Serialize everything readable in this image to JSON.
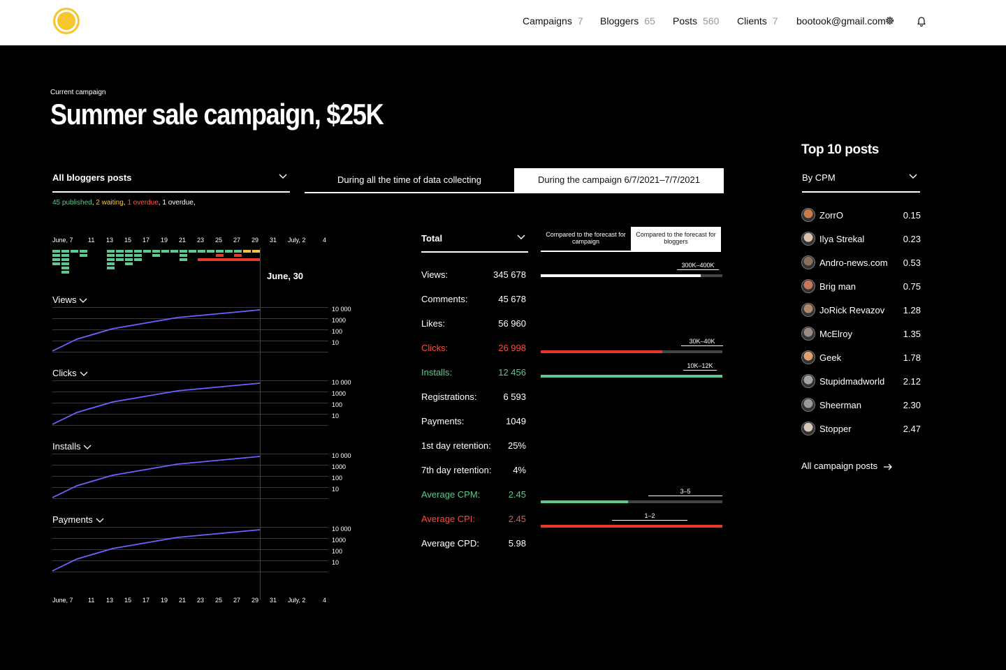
{
  "nav": {
    "items": [
      {
        "label": "Campaigns",
        "count": "7"
      },
      {
        "label": "Bloggers",
        "count": "65"
      },
      {
        "label": "Posts",
        "count": "560"
      },
      {
        "label": "Clients",
        "count": "7"
      }
    ],
    "email": "bootook@gmail.com",
    "icons": {
      "logo": "logo-circle",
      "settings": "gear-icon",
      "notifications": "bell-icon"
    },
    "logo_color": "#f5c62e"
  },
  "header": {
    "eyebrow": "Current campaign",
    "title": "Summer sale campaign, $25K"
  },
  "filter": {
    "label": "All bloggers posts",
    "summary": {
      "published": "45 published",
      "waiting": "2 waiting",
      "overdue_red": "1 overdue",
      "overdue": "1 overdue"
    }
  },
  "tabs": [
    {
      "label": "During all the time of data collecting",
      "active": false
    },
    {
      "label": "During the campaign 6/7/2021–7/7/2021",
      "active": true
    }
  ],
  "timeline": {
    "ticks": [
      "June, 7",
      "11",
      "13",
      "15",
      "17",
      "19",
      "21",
      "23",
      "25",
      "27",
      "29",
      "31",
      "July, 2",
      "4"
    ],
    "marker_label": "June, 30",
    "colors": {
      "published": "#5dc98f",
      "waiting": "#f0c73d",
      "overdue": "#e8392a"
    }
  },
  "metrics": [
    {
      "label": "Views",
      "scale": [
        "10 000",
        "1000",
        "100",
        "10"
      ]
    },
    {
      "label": "Clicks",
      "scale": [
        "10 000",
        "1000",
        "100",
        "10"
      ]
    },
    {
      "label": "Installs",
      "scale": [
        "10 000",
        "1000",
        "100",
        "10"
      ]
    },
    {
      "label": "Payments",
      "scale": [
        "10 000",
        "1000",
        "100",
        "10"
      ]
    }
  ],
  "totals": {
    "label": "Total",
    "rows": [
      {
        "name": "Views:",
        "value": "345 678",
        "tone": "white"
      },
      {
        "name": "Comments:",
        "value": "45 678",
        "tone": "white"
      },
      {
        "name": "Likes:",
        "value": "56 960",
        "tone": "white"
      },
      {
        "name": "Clicks:",
        "value": "26 998",
        "tone": "red"
      },
      {
        "name": "Installs:",
        "value": "12 456",
        "tone": "green"
      },
      {
        "name": "Registrations:",
        "value": "6 593",
        "tone": "white"
      },
      {
        "name": "Payments:",
        "value": "1049",
        "tone": "white"
      },
      {
        "name": "1st day retention:",
        "value": "25%",
        "tone": "white"
      },
      {
        "name": "7th day retention:",
        "value": "4%",
        "tone": "white"
      },
      {
        "name": "Average CPM:",
        "value": "2.45",
        "tone": "green"
      },
      {
        "name": "Average CPI:",
        "value": "2.45",
        "tone": "red"
      },
      {
        "name": "Average CPD:",
        "value": "5.98",
        "tone": "white"
      }
    ]
  },
  "compare": {
    "tabs": [
      {
        "label": "Compared to the forecast for campaign",
        "active": false
      },
      {
        "label": "Compared to the forecast for bloggers",
        "active": true
      }
    ],
    "bars": [
      {
        "metric": "Views",
        "range": "300K–400K",
        "fill": 0.88,
        "color": "#ffffff"
      },
      {
        "metric": "Clicks",
        "range": "30K–40K",
        "fill": 0.67,
        "color": "#e8392a"
      },
      {
        "metric": "Installs",
        "range": "10K–12K",
        "fill": 1.0,
        "color": "#5dc98f"
      },
      {
        "metric": "Average CPM",
        "range": "3–5",
        "fill": 0.48,
        "color": "#5dc98f"
      },
      {
        "metric": "Average CPI",
        "range": "1–2",
        "fill": 1.0,
        "color": "#e8392a"
      }
    ]
  },
  "top_posts": {
    "title": "Top 10 posts",
    "sort_label": "By CPM",
    "posts": [
      {
        "name": "ZorrO",
        "value": "0.15",
        "avatar_color": "#c97a4a"
      },
      {
        "name": "Ilya Strekal",
        "value": "0.23",
        "avatar_color": "#d9c2b0"
      },
      {
        "name": "Andro-news.com",
        "value": "0.53",
        "avatar_color": "#8a6f5a"
      },
      {
        "name": "Brig man",
        "value": "0.75",
        "avatar_color": "#c9775a"
      },
      {
        "name": "JoRick Revazov",
        "value": "1.28",
        "avatar_color": "#b08a6a"
      },
      {
        "name": "McElroy",
        "value": "1.35",
        "avatar_color": "#9a8a80"
      },
      {
        "name": "Geek",
        "value": "1.78",
        "avatar_color": "#e0a070"
      },
      {
        "name": "Stupidmadworld",
        "value": "2.12",
        "avatar_color": "#a8a0a8"
      },
      {
        "name": "Sheerman",
        "value": "2.30",
        "avatar_color": "#9a9a9a"
      },
      {
        "name": "Stopper",
        "value": "2.47",
        "avatar_color": "#d8c8b8"
      }
    ],
    "all_link": "All campaign posts",
    "all_link_icon": "arrow-right-icon"
  }
}
